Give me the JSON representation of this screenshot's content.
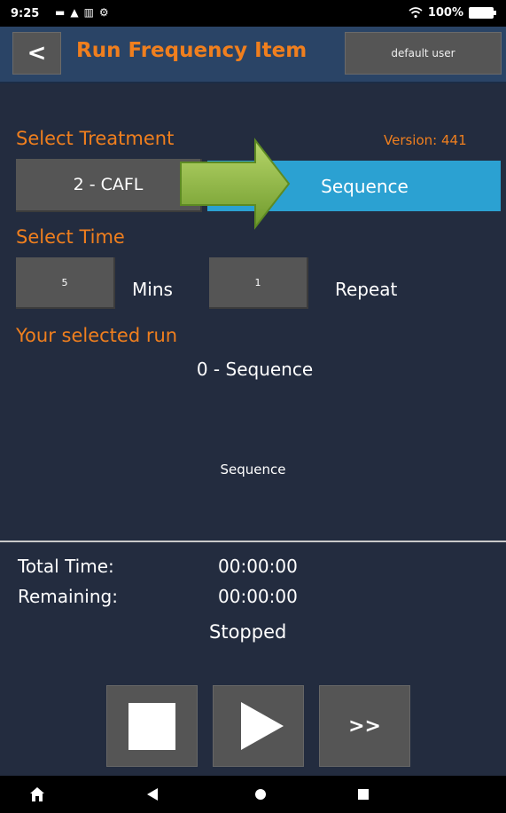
{
  "status_bar": {
    "time": "9:25",
    "notif_icons": [
      "image-icon",
      "warning-icon",
      "book-icon",
      "settings-icon"
    ],
    "wifi_icon": "wifi-icon",
    "battery_text": "100%"
  },
  "header": {
    "back_label": "<",
    "title": "Run Frequency Item",
    "user_label": "default user"
  },
  "treatment": {
    "section_label": "Select Treatment",
    "version_text": "Version: 441",
    "selected_treatment": "2 -  CAFL",
    "sequence_label": "Sequence"
  },
  "time": {
    "section_label": "Select Time",
    "mins_value": "5",
    "mins_label": "Mins",
    "repeat_value": "1",
    "repeat_label": "Repeat"
  },
  "selected_run": {
    "section_label": "Your selected run",
    "run_name": "0 -  Sequence",
    "run_detail": "Sequence"
  },
  "timer": {
    "total_label": "Total Time:",
    "total_value": "00:00:00",
    "remaining_label": "Remaining:",
    "remaining_value": "00:00:00",
    "state": "Stopped"
  },
  "controls": {
    "stop_icon": "stop-icon",
    "play_icon": "play-icon",
    "forward_label": ">>"
  },
  "nav_bar": {
    "icons": [
      "home-icon",
      "back-triangle-icon",
      "home-circle-icon",
      "recents-square-icon"
    ]
  },
  "colors": {
    "background": "#232c3f",
    "accent_orange": "#f07f1e",
    "sequence_blue": "#2ba1d2",
    "header_blue": "#2a4466",
    "button_gray": "#555555"
  }
}
